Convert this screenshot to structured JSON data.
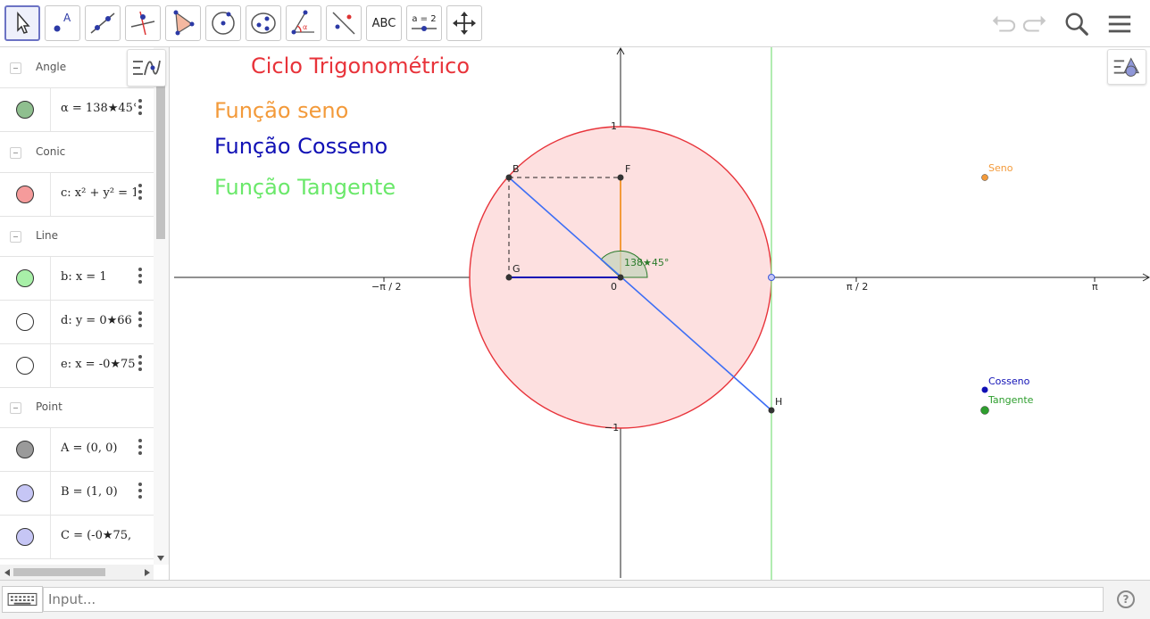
{
  "toolbar": {
    "text_tool_label": "ABC",
    "slider_tool_label": "a = 2"
  },
  "algebra": {
    "groups": [
      {
        "label": "Angle",
        "items": [
          {
            "definition": "α = 138★45°",
            "color": "#8fbf8f"
          }
        ]
      },
      {
        "label": "Conic",
        "items": [
          {
            "definition": "c: x² + y² = 1",
            "color": "#f59b9b"
          }
        ]
      },
      {
        "label": "Line",
        "items": [
          {
            "definition": "b: x = 1",
            "color": "#a8f0a8"
          },
          {
            "definition": "d: y = 0★66",
            "color": "#ffffff"
          },
          {
            "definition": "e: x = -0★75",
            "color": "#ffffff"
          }
        ]
      },
      {
        "label": "Point",
        "items": [
          {
            "definition": "A = (0, 0)",
            "color": "#9a9a9a"
          },
          {
            "definition": "B = (1, 0)",
            "color": "#c6c6f5"
          },
          {
            "definition": "C = (-0★75, 0★",
            "color": "#c6c6f5"
          }
        ]
      }
    ]
  },
  "graphics": {
    "title": "Ciclo Trigonométrico",
    "legend": {
      "sine": "Função seno",
      "cosine": "Função Cosseno",
      "tangent": "Função Tangente"
    },
    "axis_labels": {
      "x_neg_half_pi": "−π / 2",
      "x_zero": "0",
      "x_half_pi": "π / 2",
      "x_pi": "π",
      "y_one": "1",
      "y_neg_one": "−1"
    },
    "angle_label": "138★45°",
    "point_labels": {
      "B_on_circle": "B",
      "F": "F",
      "G": "G",
      "H": "H"
    },
    "markers": {
      "sine": "Seno",
      "cosine": "Cosseno",
      "tangent": "Tangente"
    },
    "colors": {
      "title": "#e8333a",
      "sine": "#f39a3a",
      "cosine": "#1010b5",
      "tangent": "#6ae86a",
      "circle": "#e8333a",
      "circle_fill": "#fde0e0",
      "radius_line": "#3d6ef5",
      "tangent_line": "#7de07d",
      "angle_label": "#2a7a2a"
    }
  },
  "input": {
    "placeholder": "Input..."
  },
  "help_label": "?"
}
